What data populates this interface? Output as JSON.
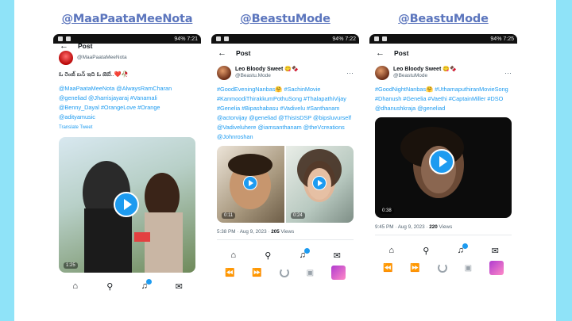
{
  "columns": [
    {
      "handle": "@MaaPaataMeeNota",
      "status": {
        "time": "",
        "battery": "94% 7:21"
      },
      "topbar": {
        "title": "Post"
      },
      "author": {
        "name": "",
        "handle": "@MaaPaataMeeNota"
      },
      "tweet": {
        "text": "ఓ రెంజ్ బన్ ఇది ఓ జెబే..❤️🥀",
        "hashtags": "@MaaPaataMeeNota @AlwaysRamCharan @geneliad @Jharrisjayaraj #Vanamali @Benny_Dayal #OrangeLove #Orange @adityamusic",
        "translate": "Translate Tweet"
      },
      "media": {
        "duration": "1:25"
      },
      "meta": {
        "time": "",
        "views": ""
      }
    },
    {
      "handle": "@BeastuMode",
      "status": {
        "time": "",
        "battery": "94% 7:22"
      },
      "topbar": {
        "title": "Post"
      },
      "author": {
        "name": "Leo Bloody Sweet 😋🍫",
        "handle": "@Beastu.Mode"
      },
      "tweet": {
        "text": "",
        "hashtags": "#GoodEveningNanbas🤗 #SachinMovie #KanmoodiThirakkumPothuSong #ThalapathiVijay #Genelia #Bipashabasu #Vadivelu #Santhanam @actorvijay @geneliad @ThisIsDSP @bipsluvurself @Vadiveluhere @iamsanthanam @theVcreations @Johnroshan",
        "translate": ""
      },
      "media": {
        "duration_left": "0:11",
        "duration_right": "0:24"
      },
      "meta": {
        "time": "5:38 PM · Aug 9, 2023 · ",
        "views_count": "205",
        "views_label": " Views"
      }
    },
    {
      "handle": "@BeastuMode",
      "status": {
        "time": "",
        "battery": "94% 7:25"
      },
      "topbar": {
        "title": "Post"
      },
      "author": {
        "name": "Leo Bloody Sweet 😋🍫",
        "handle": "@BeastuMode"
      },
      "tweet": {
        "text": "",
        "hashtags": "#GoodNightNanbas🤗 #UthamaputhiranMovieSong #Dhanush #Genelia #Vaethi #CaptainMiller #DSO @dhanushkraja @geneliad",
        "translate": ""
      },
      "media": {
        "duration": "0:38"
      },
      "meta": {
        "time": "9:45 PM · Aug 9, 2023 · ",
        "views_count": "220",
        "views_label": " Views"
      }
    }
  ],
  "colors": {
    "link": "#1d9bf0",
    "handle": "#5b75bd",
    "background": "#8fe3f8"
  },
  "icons": [
    "home-icon",
    "search-icon",
    "bell-icon",
    "mail-icon",
    "back-arrow-icon",
    "more-icon",
    "play-icon"
  ]
}
